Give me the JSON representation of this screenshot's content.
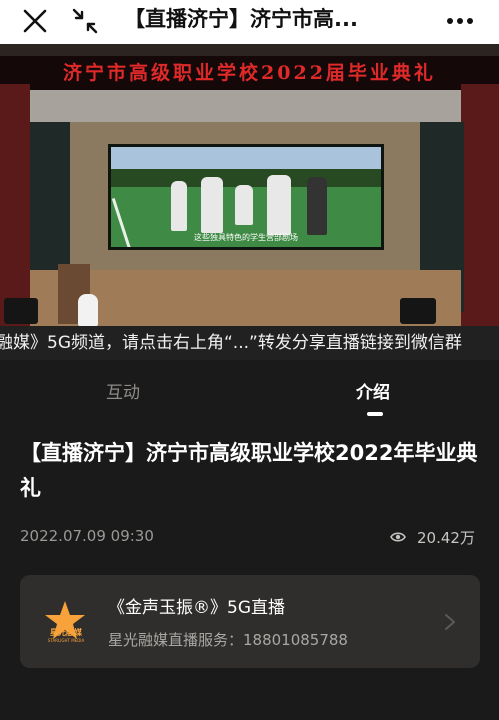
{
  "topbar": {
    "title": "【直播济宁】济宁市高..."
  },
  "video": {
    "banner": "济宁市高级职业学校2022届毕业典礼",
    "screen_caption": "这些独具特色的学生营部剧场"
  },
  "ticker": {
    "text": "融媒》5G频道，请点击右上角“...”转发分享直播链接到微信群"
  },
  "tabs": [
    {
      "label": "互动",
      "active": false
    },
    {
      "label": "介绍",
      "active": true
    }
  ],
  "content": {
    "title": "【直播济宁】济宁市高级职业学校2022年毕业典礼",
    "date": "2022.07.09 09:30",
    "views": "20.42万"
  },
  "card": {
    "logo_text": "星光融媒",
    "logo_sub": "STARLIGHT MEDIA",
    "name": "《金声玉振®》5G直播",
    "service": "星光融媒直播服务：18801085788"
  },
  "colors": {
    "background": "#1b1a1a",
    "card": "#2f2e2d",
    "banner_red": "#e02a2a",
    "logo_orange": "#f7a23a"
  }
}
